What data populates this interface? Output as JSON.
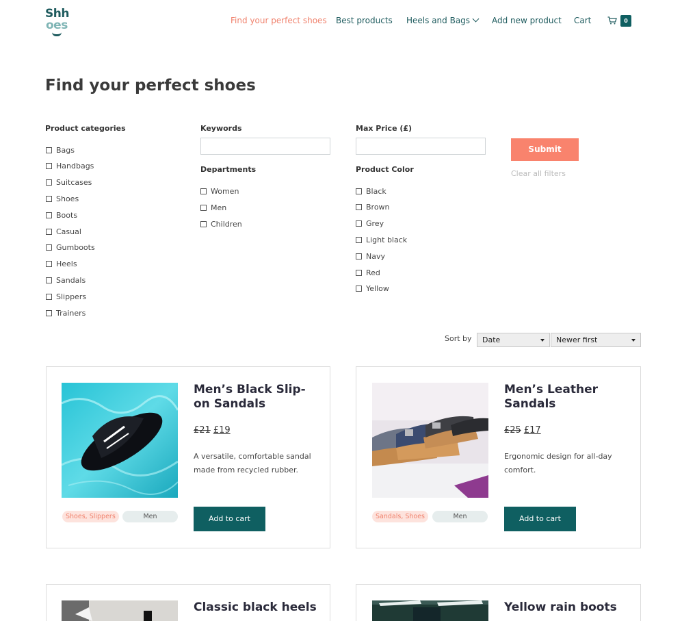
{
  "logo": {
    "line1": "Shh",
    "line2": "oes"
  },
  "nav": {
    "items": [
      {
        "label": "Find your perfect shoes",
        "active": true
      },
      {
        "label": "Best products"
      },
      {
        "label": "Heels and Bags"
      },
      {
        "label": "Add new product"
      },
      {
        "label": "Cart"
      }
    ],
    "cart_count": "0"
  },
  "page_title": "Find your perfect shoes",
  "filters": {
    "categories_label": "Product categories",
    "categories": [
      "Bags",
      "Handbags",
      "Suitcases",
      "Shoes",
      "Boots",
      "Casual",
      "Gumboots",
      "Heels",
      "Sandals",
      "Slippers",
      "Trainers"
    ],
    "keywords_label": "Keywords",
    "keywords_value": "",
    "departments_label": "Departments",
    "departments": [
      "Women",
      "Men",
      "Children"
    ],
    "max_price_label": "Max Price (£)",
    "max_price_value": "",
    "color_label": "Product Color",
    "colors": [
      "Black",
      "Brown",
      "Grey",
      "Light black",
      "Navy",
      "Red",
      "Yellow"
    ],
    "submit_label": "Submit",
    "clear_label": "Clear all filters"
  },
  "sort": {
    "label": "Sort by",
    "field": "Date",
    "order": "Newer first"
  },
  "products": [
    {
      "title": "Men’s Black Slip-on Sandals",
      "old_price": "£21",
      "price": "£19",
      "description": "A versatile, comfortable sandal made from recycled rubber.",
      "categories": "Shoes, Slippers",
      "department": "Men",
      "button": "Add to cart"
    },
    {
      "title": "Men’s Leather Sandals",
      "old_price": "£25",
      "price": "£17",
      "description": "Ergonomic design for all-day comfort.",
      "categories": "Sandals, Shoes",
      "department": "Men",
      "button": "Add to cart"
    },
    {
      "title": "Classic black heels"
    },
    {
      "title": "Yellow rain boots"
    }
  ],
  "colors": {
    "accent": "#f0826d",
    "primary": "#0f5f61",
    "submit": "#f9836d"
  }
}
